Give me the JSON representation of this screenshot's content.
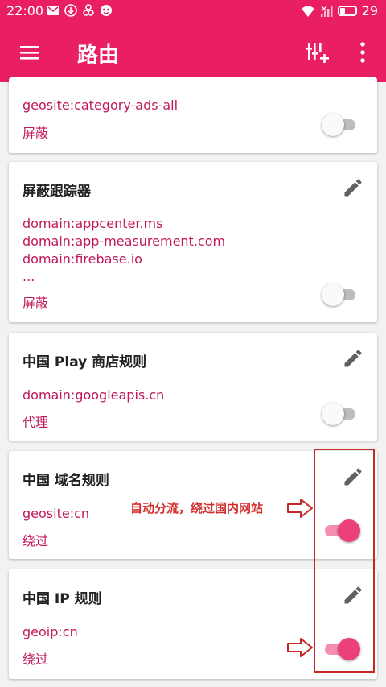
{
  "status_bar": {
    "time": "22:00",
    "battery": "29",
    "icons_left": [
      "mail-icon",
      "download-icon",
      "link-icon",
      "game-icon"
    ],
    "icons_right": [
      "wifi-icon",
      "no-signal-icon",
      "battery-icon"
    ]
  },
  "app_bar": {
    "title": "路由",
    "icons": [
      "menu-icon",
      "add-rule-icon",
      "more-vert-icon"
    ]
  },
  "rules": [
    {
      "title": "",
      "domains": [
        "geosite:category-ads-all"
      ],
      "action": "屏蔽",
      "enabled": false
    },
    {
      "title": "屏蔽跟踪器",
      "domains": [
        "domain:appcenter.ms",
        "domain:app-measurement.com",
        "domain:firebase.io",
        "..."
      ],
      "action": "屏蔽",
      "enabled": false
    },
    {
      "title": "中国 Play 商店规则",
      "domains": [
        "domain:googleapis.cn"
      ],
      "action": "代理",
      "enabled": false
    },
    {
      "title": "中国 域名规则",
      "domains": [
        "geosite:cn"
      ],
      "action": "绕过",
      "enabled": true
    },
    {
      "title": "中国 IP 规则",
      "domains": [
        "geoip:cn"
      ],
      "action": "绕过",
      "enabled": true
    }
  ],
  "annotation": {
    "text": "自动分流，绕过国内网站",
    "color": "#d32f2f"
  },
  "colors": {
    "primary": "#e91e63",
    "rule_text": "#c2185b",
    "toggle_on": "#ec407a"
  }
}
